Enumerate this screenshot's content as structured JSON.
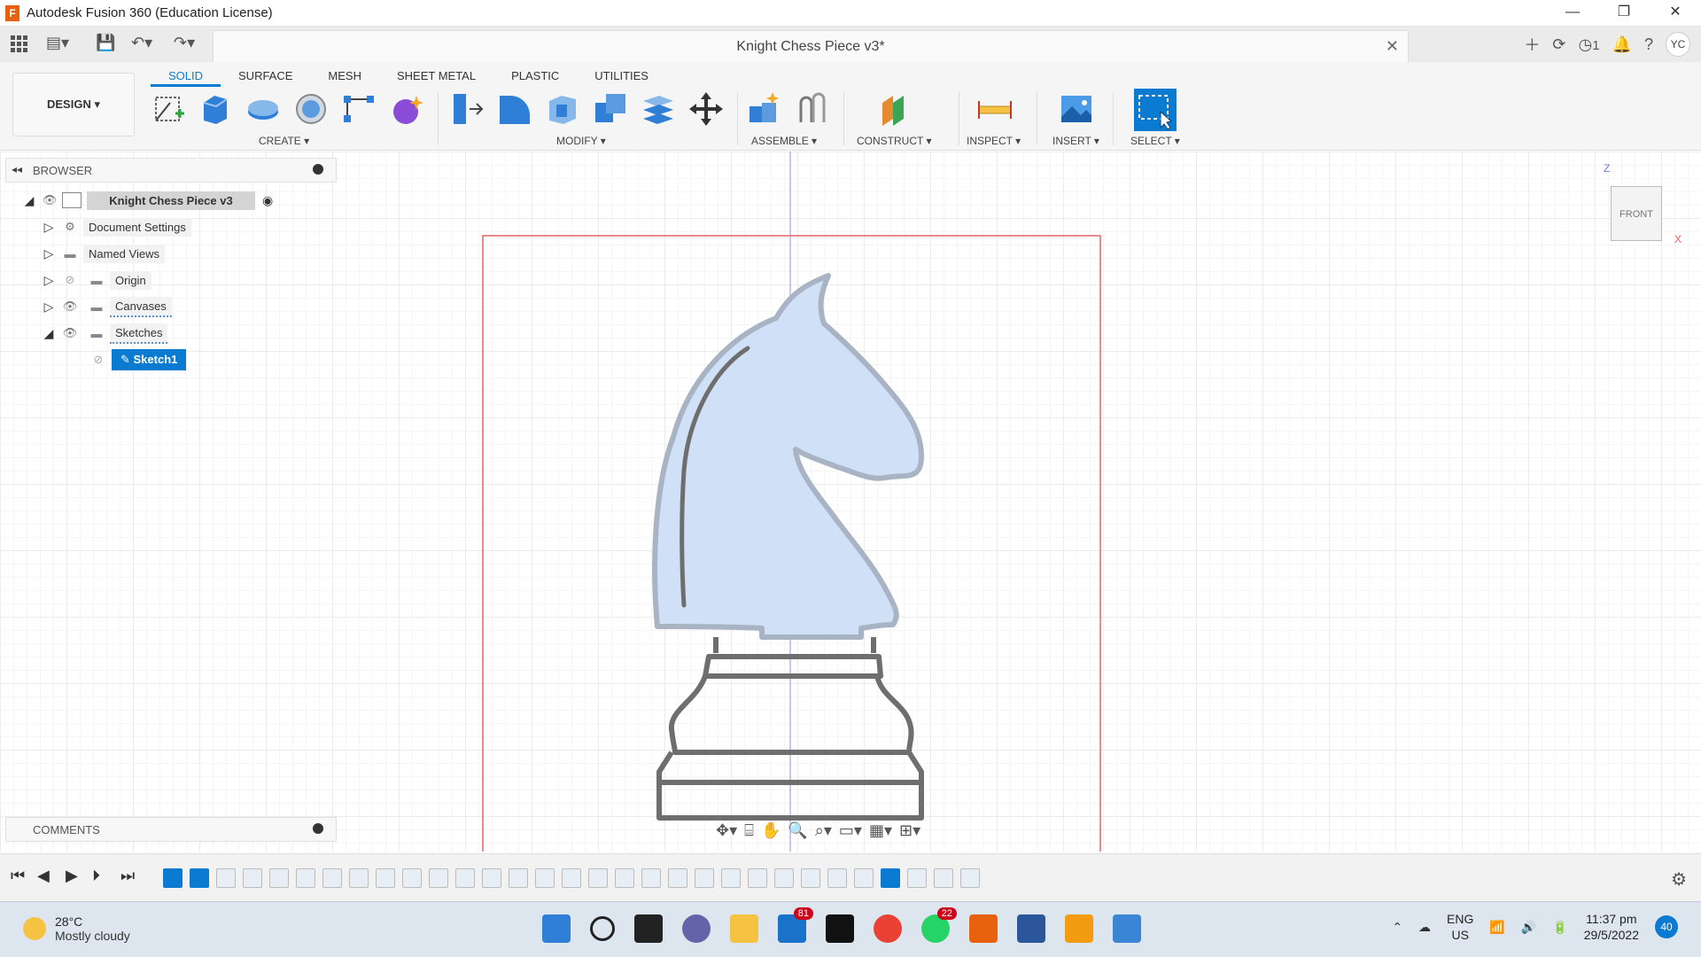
{
  "window": {
    "title": "Autodesk Fusion 360 (Education License)",
    "logo": "F",
    "minimize": "—",
    "restore": "❐",
    "close": "✕"
  },
  "document": {
    "title": "Knight Chess Piece v3*",
    "close": "✕"
  },
  "qat": {
    "avatar": "YC",
    "jobs_count": "1"
  },
  "workspace": {
    "label": "DESIGN ▾"
  },
  "tabs": [
    {
      "label": "SOLID"
    },
    {
      "label": "SURFACE"
    },
    {
      "label": "MESH"
    },
    {
      "label": "SHEET METAL"
    },
    {
      "label": "PLASTIC"
    },
    {
      "label": "UTILITIES"
    }
  ],
  "groups": {
    "create": "CREATE ▾",
    "modify": "MODIFY ▾",
    "assemble": "ASSEMBLE ▾",
    "construct": "CONSTRUCT ▾",
    "inspect": "INSPECT ▾",
    "insert": "INSERT ▾",
    "select": "SELECT ▾"
  },
  "browser": {
    "title": "BROWSER",
    "root": "Knight Chess Piece v3",
    "items": [
      {
        "label": "Document Settings"
      },
      {
        "label": "Named Views"
      },
      {
        "label": "Origin"
      },
      {
        "label": "Canvases"
      },
      {
        "label": "Sketches"
      },
      {
        "label": "Sketch1"
      }
    ]
  },
  "comments": {
    "title": "COMMENTS"
  },
  "viewcube": {
    "face": "FRONT",
    "axis_z": "Z",
    "axis_x": "X"
  },
  "taskbar": {
    "weather_temp": "28°C",
    "weather_cond": "Mostly cloudy",
    "mail_badge": "81",
    "whatsapp_badge": "22",
    "lang_1": "ENG",
    "lang_2": "US",
    "time": "11:37 pm",
    "date": "29/5/2022",
    "notifications": "40"
  },
  "colors": {
    "accent": "#0b7bd1",
    "fill": "#cfe0f7",
    "outline": "#6e6e6e",
    "sketch_frame": "#e06666"
  }
}
